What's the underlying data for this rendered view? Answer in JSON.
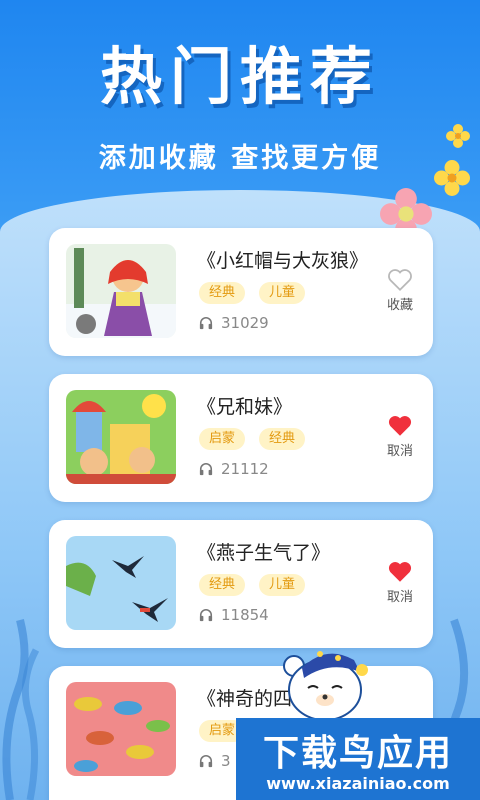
{
  "header": {
    "headline": "热门推荐",
    "subline": "添加收藏 查找更方便"
  },
  "stories": [
    {
      "title": "《小红帽与大灰狼》",
      "tags": [
        "经典",
        "儿童"
      ],
      "plays": "31029",
      "fav_label": "收藏",
      "favorited": false
    },
    {
      "title": "《兄和妹》",
      "tags": [
        "启蒙",
        "经典"
      ],
      "plays": "21112",
      "fav_label": "取消",
      "favorited": true
    },
    {
      "title": "《燕子生气了》",
      "tags": [
        "经典",
        "儿童"
      ],
      "plays": "11854",
      "fav_label": "取消",
      "favorited": true
    },
    {
      "title": "《神奇的四",
      "tags": [
        "启蒙"
      ],
      "plays": "3",
      "fav_label": "",
      "favorited": false
    }
  ],
  "icons": {
    "play_count": "headphones-icon",
    "favorite": "heart-icon"
  },
  "colors": {
    "primary": "#1f86f0",
    "tag_bg": "#fff3c6",
    "tag_text": "#e39a10",
    "heart": "#f0303c"
  },
  "watermark": {
    "name": "下载鸟应用",
    "url": "www.xiazainiao.com"
  }
}
